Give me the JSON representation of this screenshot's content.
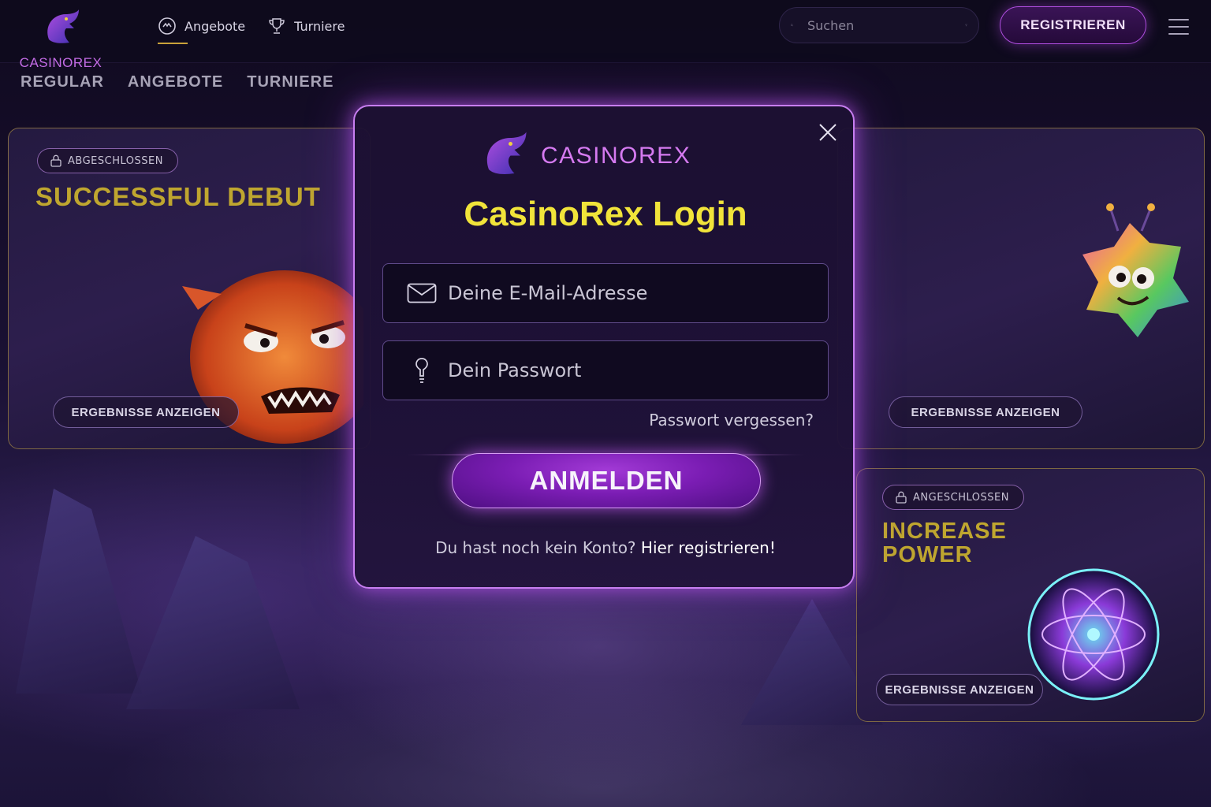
{
  "header": {
    "logo_text": "CASINOREX",
    "nav": [
      {
        "label": "Angebote",
        "icon": "offers-icon"
      },
      {
        "label": "Turniere",
        "icon": "trophy-icon"
      }
    ],
    "search_placeholder": "Suchen",
    "register_label": "REGISTRIEREN"
  },
  "subnav": [
    "REGULAR",
    "ANGEBOTE",
    "TURNIERE"
  ],
  "cards": [
    {
      "badge": "ABGESCHLOSSEN",
      "title": "SUCCESSFUL DEBUT",
      "button": "ERGEBNISSE ANZEIGEN"
    },
    {
      "button": "ERGEBNISSE ANZEIGEN"
    },
    {
      "badge": "ANGESCHLOSSEN",
      "title_line1": "INCREASE",
      "title_line2": "POWER",
      "button": "ERGEBNISSE ANZEIGEN"
    }
  ],
  "modal": {
    "logo_text": "CASINOREX",
    "title": "CasinoRex Login",
    "email_placeholder": "Deine E-Mail-Adresse",
    "password_placeholder": "Dein Passwort",
    "forgot": "Passwort vergessen?",
    "login_button": "ANMELDEN",
    "no_account": "Du hast noch kein Konto?",
    "register_link": "Hier registrieren!"
  },
  "colors": {
    "accent_purple": "#b04ee0",
    "title_yellow": "#f1e43a",
    "card_title_gold": "#bfa62f"
  }
}
